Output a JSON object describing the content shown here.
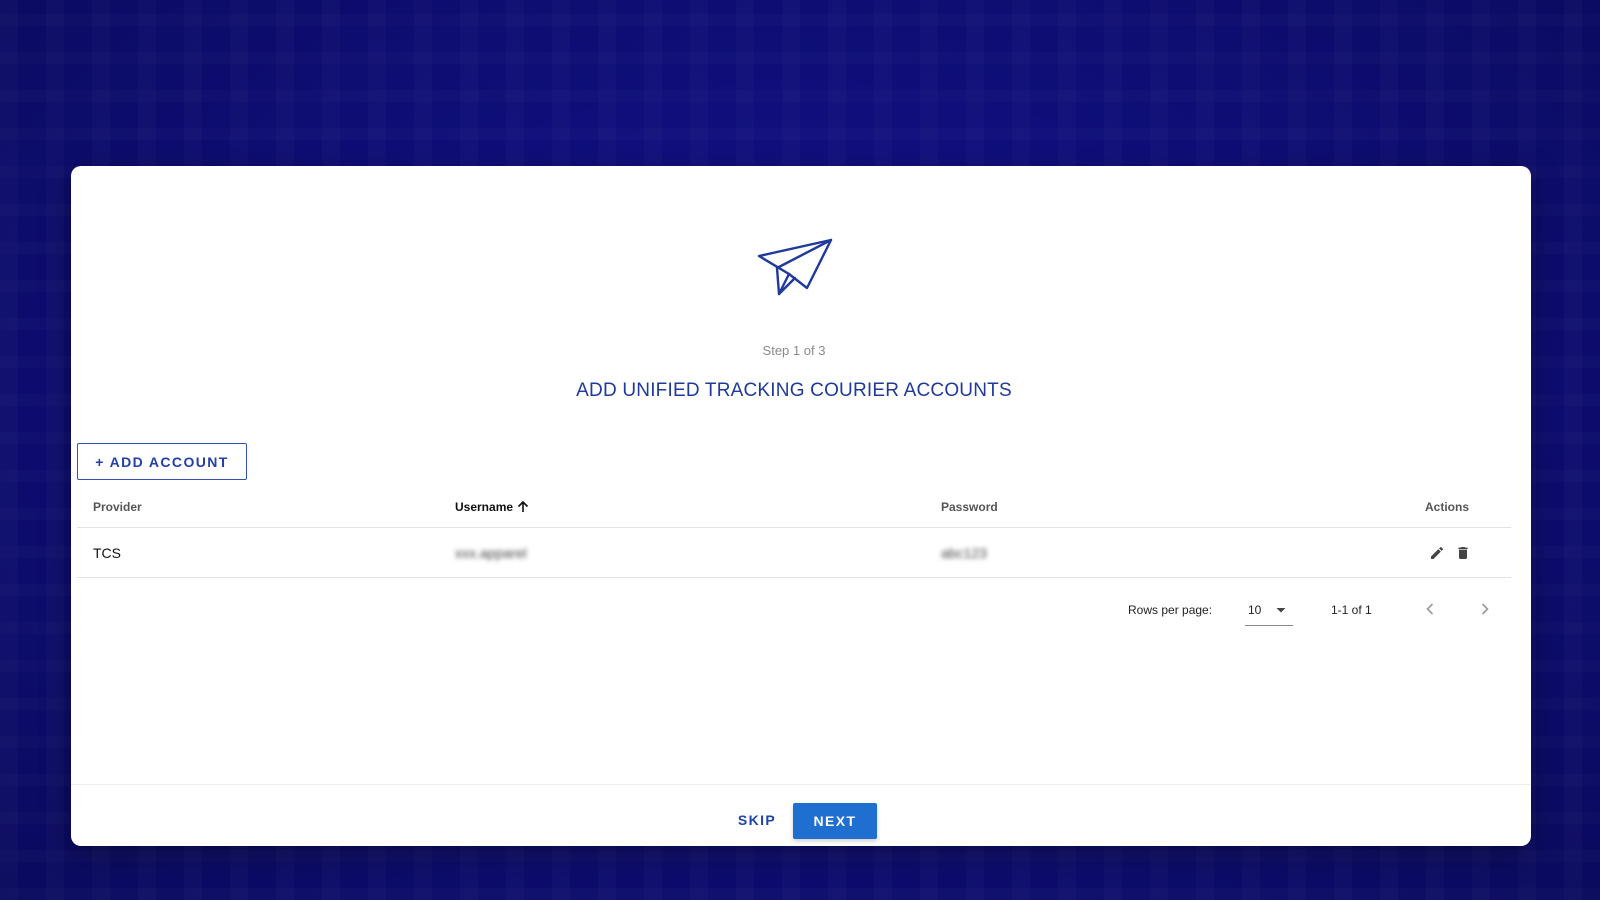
{
  "wizard": {
    "step_text": "Step 1 of 3",
    "title": "ADD UNIFIED TRACKING COURIER ACCOUNTS",
    "hero_icon": "paper-plane-icon"
  },
  "toolbar": {
    "add_account_label": "+ ADD ACCOUNT"
  },
  "table": {
    "columns": {
      "provider": "Provider",
      "username": "Username",
      "password": "Password",
      "actions": "Actions"
    },
    "sorted_column": "username",
    "sort_direction": "ascending",
    "rows": [
      {
        "provider": "TCS",
        "username": "xxx.apparel",
        "password": "abc123",
        "actions": [
          "edit-icon",
          "delete-icon"
        ]
      }
    ]
  },
  "pagination": {
    "rows_per_page_label": "Rows per page:",
    "rows_per_page_value": "10",
    "range_text": "1-1 of 1"
  },
  "footer": {
    "skip_label": "SKIP",
    "next_label": "NEXT"
  },
  "colors": {
    "background": "#12118a",
    "accent": "#1f3a9a",
    "primary_button": "#1f6fd1"
  }
}
